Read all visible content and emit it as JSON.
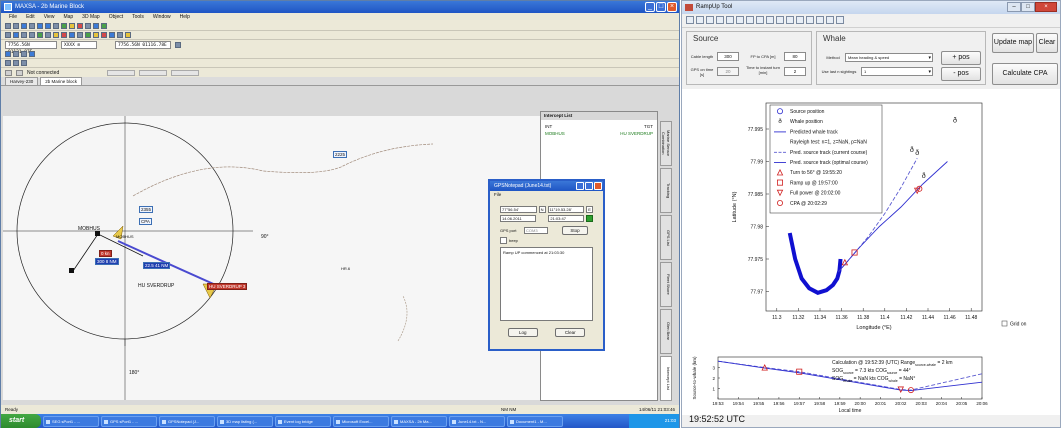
{
  "left_window": {
    "title": "MAXSA - 2b Marine Block",
    "menu": [
      "File",
      "Edit",
      "View",
      "Map",
      "3D Map",
      "Object",
      "Tools",
      "Window",
      "Help"
    ],
    "position_fields": [
      "7756.56N 01121.87E",
      "XXXX m",
      "7756.56N 01116.78E"
    ],
    "status_text": "Not connected",
    "tabs": [
      "Harvey-230",
      "2b Marine block"
    ],
    "intercept_panel": {
      "title": "Intercept List",
      "col_int": "INT",
      "col_tgt": "TGT",
      "row_int": "MOBHUS",
      "row_tgt": "HU SVERDRUP"
    },
    "side_tabs": [
      "Marine Sensor Combination",
      "Tracking",
      "GPS List",
      "Fleet Shore",
      "Olen Bear",
      "Intercept List"
    ],
    "map_labels": {
      "deg_90": "90°",
      "deg_180": "180°",
      "ship_own": "MOBHUS",
      "ship_target": "HU SVERDRUP",
      "box_2225": "2225",
      "box_2355": "2355",
      "box_cpa": "CPA",
      "box_speed1": "0 kn",
      "box_speed2": "300 8 NM",
      "box_speed3": "22.5 41 NM",
      "tag_red": "0 kn",
      "tag_target": "HU SVERDRUP 3",
      "target_small": "MOBHUS",
      "scale": "HR.6"
    },
    "gps_dialog": {
      "title": "GPSNotepad (June14.txt)",
      "menu": "File",
      "lat": "77°56.54'",
      "lat_hemi": "N",
      "lon": "11°19.53.28'",
      "lon_hemi": "E",
      "date": "14.06.2011",
      "time": "21:03:47",
      "gps_port_label": "GPS port",
      "gps_port_value": "COM3",
      "stop_label": "Stop",
      "beep_label": "beep",
      "log_text": "Ramp UP commenced at 21:03:30",
      "log_button": "Log",
      "clear_button": "Clear"
    },
    "statusbar": {
      "left": "Ready",
      "middle": "NM    NM",
      "right": "14/06/11  21:03:46"
    },
    "taskbar": {
      "start": "start",
      "tasks": [
        "SEG sPort1 - ...",
        "GPS sPort1 - ...",
        "GPSNotepad (J...",
        "3D map listing (...",
        "Event log bridge",
        "Microsoft Excel...",
        "MAXSA - 2b Ma...",
        "June14.txt - N...",
        "Document1 - M..."
      ],
      "tray": "21:03"
    }
  },
  "right_window": {
    "title": "RampUp Tool",
    "source": {
      "heading": "Source",
      "cable_length_label": "Cable length",
      "cable_length": "300",
      "fp_cpa_label": "FP to CPA [m]",
      "fp_cpa": "80",
      "gps_on_time_label": "GPS on time [s]",
      "gps_on_time": "20",
      "time_to_instant_label": "Time to instant turn [min]",
      "time_to_instant": "2"
    },
    "whale": {
      "heading": "Whale",
      "method_label": "Method",
      "method_value": "Mean heading & speed",
      "use_last_label": "Use last n sightings",
      "use_last_value": "1",
      "plus_pos": "+ pos",
      "minus_pos": "- pos"
    },
    "buttons": {
      "update_map": "Update map",
      "clear": "Clear",
      "calculate_cpa": "Calculate CPA"
    },
    "clock": "19:52:52 UTC",
    "grid_on_label": "Grid on"
  },
  "chart_data": [
    {
      "type": "line",
      "title": "",
      "xlabel": "Longitude (°E)",
      "ylabel": "Latitude (°N)",
      "xlim": [
        11.29,
        11.49
      ],
      "ylim": [
        77.967,
        77.999
      ],
      "xticks": [
        11.3,
        11.32,
        11.34,
        11.36,
        11.38,
        11.4,
        11.42,
        11.44,
        11.46,
        11.48
      ],
      "yticks": [
        77.97,
        77.975,
        77.98,
        77.985,
        77.99,
        77.995
      ],
      "ytick_labels": [
        "77.97",
        "77.975",
        "77.98",
        "77.985",
        "77.99",
        "77.995"
      ],
      "legend": [
        "Source position",
        "Whale position",
        "Predicted whale track",
        "Rayleigh test: n=1, z=NaN, p=NaN",
        "Pred. source track (current course)",
        "Pred. source track (optimal course)",
        "Turn to 56° @ 19:55:20",
        "Ramp up @ 19:57:00",
        "Full power @ 20:02:00",
        "CPA @ 20:02:29"
      ],
      "series": [
        {
          "name": "Predicted whale track",
          "color": "#1010d0",
          "x": [
            11.312,
            11.317,
            11.323,
            11.33,
            11.338,
            11.346,
            11.352,
            11.356,
            11.358,
            11.359
          ],
          "y": [
            77.979,
            77.975,
            77.972,
            77.9705,
            77.9698,
            77.9702,
            77.971,
            77.972,
            77.9732,
            77.975
          ]
        },
        {
          "name": "Pred. source track (current course)",
          "color": "#5a5ad0",
          "dashed": true,
          "x": [
            11.357,
            11.37,
            11.385,
            11.4,
            11.415,
            11.43
          ],
          "y": [
            77.973,
            77.9755,
            77.9785,
            77.982,
            77.986,
            77.9905
          ]
        },
        {
          "name": "Pred. source track (optimal course)",
          "color": "#3030d0",
          "x": [
            11.357,
            11.375,
            11.395,
            11.415,
            11.435,
            11.458
          ],
          "y": [
            77.973,
            77.9765,
            77.98,
            77.983,
            77.9865,
            77.99
          ]
        }
      ],
      "whale_positions": [
        {
          "x": 11.465,
          "y": 77.996
        },
        {
          "x": 11.425,
          "y": 77.9915
        },
        {
          "x": 11.43,
          "y": 77.991
        },
        {
          "x": 11.436,
          "y": 77.9875
        }
      ],
      "events": [
        {
          "label": "Turn to 56° @ 19:55:20",
          "marker": "triangle-up",
          "x": 11.363,
          "y": 77.9745
        },
        {
          "label": "Ramp up @ 19:57:00",
          "marker": "square",
          "x": 11.372,
          "y": 77.976
        },
        {
          "label": "Full power @ 20:02:00",
          "marker": "triangle-down",
          "x": 11.43,
          "y": 77.9855
        },
        {
          "label": "CPA @ 20:02:29",
          "marker": "circle",
          "x": 11.432,
          "y": 77.9858
        }
      ]
    },
    {
      "type": "line",
      "title": "",
      "xlabel": "Local time",
      "ylabel": "Source-to-whale (km)",
      "xticks": [
        "19:53",
        "19:54",
        "19:55",
        "19:56",
        "19:57",
        "19:58",
        "19:59",
        "20:00",
        "20:01",
        "20:02",
        "20:03",
        "20:04",
        "20:05",
        "20:06"
      ],
      "xlim": [
        0,
        13
      ],
      "ylim": [
        0,
        4
      ],
      "yticks": [
        1,
        2,
        3
      ],
      "annotation": {
        "line1": "Calculation @ 19:52:39 (UTC)   Range",
        "line1_sub": "source-whale",
        "line1_tail": " = 2 km",
        "line2": "SOG",
        "line2_sub": "source",
        "line2_val": " = 7.3 kts   COG",
        "line2_sub2": "source",
        "line2_tail": " = 44°",
        "line3": "SOG",
        "line3_sub": "whale",
        "line3_val": " = NaN kts   COG",
        "line3_sub2": "whale",
        "line3_tail": " = NaN°"
      },
      "series": [
        {
          "name": "",
          "color": "#5a5ad0",
          "dashed": true,
          "x": [
            0,
            2.3,
            4.0,
            9.0,
            9.5,
            13
          ],
          "y": [
            3.6,
            3.0,
            2.6,
            0.9,
            0.85,
            2.4
          ]
        },
        {
          "name": "",
          "color": "#3030d0",
          "x": [
            0,
            2.3,
            4.0,
            9.0,
            9.5,
            13
          ],
          "y": [
            3.6,
            2.95,
            2.5,
            0.85,
            0.8,
            1.6
          ]
        }
      ],
      "events": [
        {
          "marker": "triangle-up",
          "x": 2.3,
          "y": 3.0
        },
        {
          "marker": "square",
          "x": 4.0,
          "y": 2.6
        },
        {
          "marker": "triangle-down",
          "x": 9.0,
          "y": 0.9
        },
        {
          "marker": "circle",
          "x": 9.5,
          "y": 0.85
        }
      ]
    }
  ]
}
